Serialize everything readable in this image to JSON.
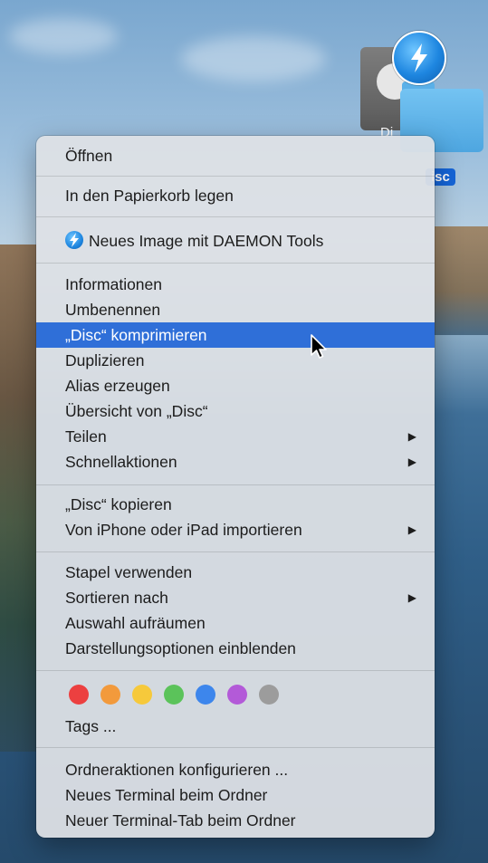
{
  "desktop": {
    "folder_label": "isc",
    "disk_label": "Di"
  },
  "menu": {
    "open": "Öffnen",
    "trash": "In den Papierkorb legen",
    "daemon": "Neues Image mit DAEMON Tools",
    "info": "Informationen",
    "rename": "Umbenennen",
    "compress": "„Disc“ komprimieren",
    "duplicate": "Duplizieren",
    "alias": "Alias erzeugen",
    "quicklook": "Übersicht von „Disc“",
    "share": "Teilen",
    "quick_actions": "Schnellaktionen",
    "copy": "„Disc“ kopieren",
    "import": "Von iPhone oder iPad importieren",
    "use_stacks": "Stapel verwenden",
    "sort_by": "Sortieren nach",
    "clean_up": "Auswahl aufräumen",
    "view_options": "Darstellungsoptionen einblenden",
    "tags": "Tags ...",
    "folder_actions": "Ordneraktionen konfigurieren ...",
    "new_terminal": "Neues Terminal beim Ordner",
    "new_terminal_tab": "Neuer Terminal-Tab beim Ordner",
    "submenu_arrow": "▶"
  },
  "tag_colors": [
    "#ec4040",
    "#f29a3c",
    "#f6c93b",
    "#5bc35a",
    "#3d86ec",
    "#b35ad8",
    "#9c9c9c"
  ]
}
